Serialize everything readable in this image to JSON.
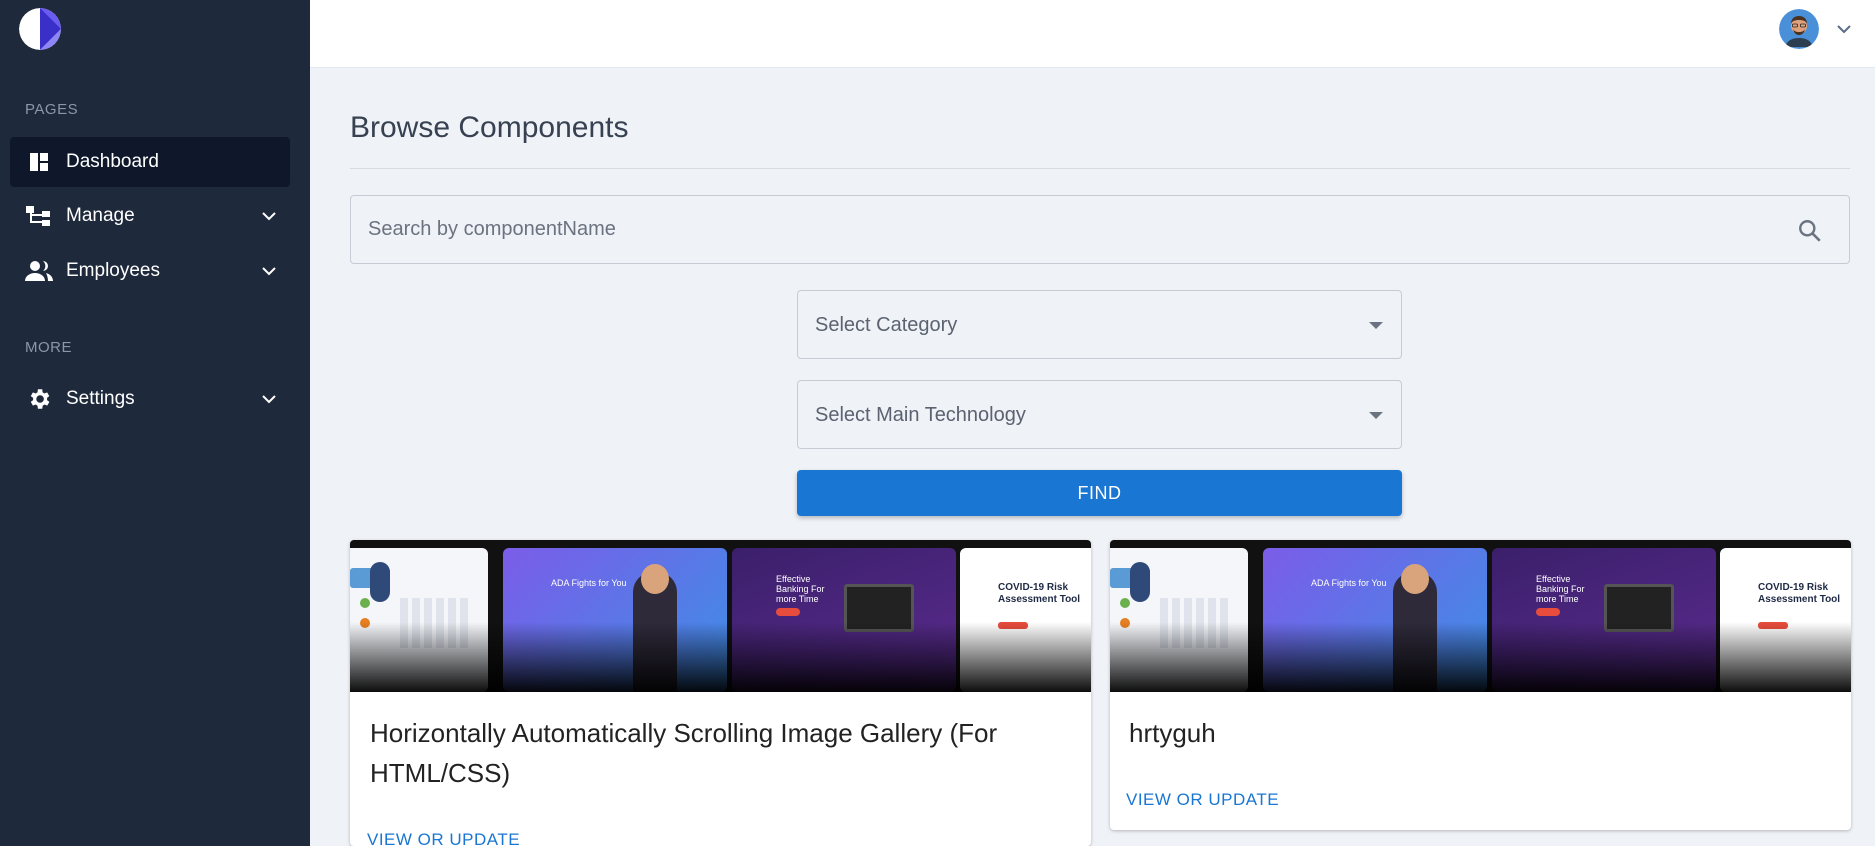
{
  "sidebar": {
    "sections": [
      {
        "title": "PAGES"
      },
      {
        "title": "MORE"
      }
    ],
    "items": [
      {
        "label": "Dashboard",
        "icon": "dashboard-icon",
        "active": true
      },
      {
        "label": "Manage",
        "icon": "hierarchy-icon"
      },
      {
        "label": "Employees",
        "icon": "people-icon"
      },
      {
        "label": "Settings",
        "icon": "gear-icon"
      }
    ]
  },
  "header": {
    "avatar": "user-avatar"
  },
  "main": {
    "title": "Browse Components",
    "search": {
      "placeholder": "Search by componentName",
      "value": ""
    },
    "category_select": {
      "value": "Select Category"
    },
    "technology_select": {
      "value": "Select Main Technology"
    },
    "find_label": "FIND",
    "cards": [
      {
        "title": "Horizontally Automatically Scrolling Image Gallery (For HTML/CSS)",
        "link": "VIEW OR UPDATE"
      },
      {
        "title": "hrtyguh",
        "link": "VIEW OR UPDATE"
      }
    ],
    "gallery_shots": [
      {
        "heading": "ADA Fights for You"
      },
      {
        "heading": "Effective Banking For more Time"
      },
      {
        "heading": "COVID-19 Risk Assessment Tool"
      }
    ]
  },
  "colors": {
    "sidebar": "#1e293b",
    "active": "#0f172a",
    "accent": "#1976d2",
    "background": "#eff2f7"
  }
}
